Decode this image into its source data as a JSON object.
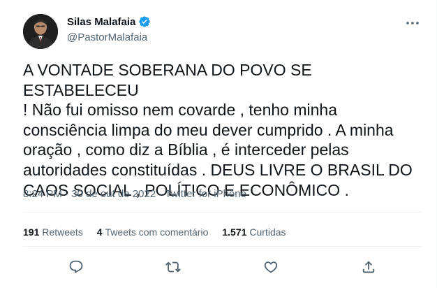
{
  "tweet": {
    "author_name": "Silas Malafaia",
    "author_handle": "@PastorMalafaia",
    "text": "A VONTADE SOBERANA DO POVO SE ESTABELECEU\n! Não fui omisso nem covarde , tenho minha\nconsciência limpa do meu dever cumprido . A minha\noração , como diz a Bíblia , é interceder pelas\nautoridades constituídas . DEUS LIVRE O BRASIL DO\nCAOS SOCIAL , POLÍTICO E ECONÔMICO .",
    "time": "8:24 PM",
    "dot": "·",
    "date": "30 de out de 2022",
    "source": "Twitter for iPhone"
  },
  "stats": {
    "retweets_count": "191",
    "retweets_label": "Retweets",
    "quotes_count": "4",
    "quotes_label": "Tweets com comentário",
    "likes_count": "1.571",
    "likes_label": "Curtidas"
  },
  "icons": {
    "verified": "verified-badge-icon",
    "more": "more-options-icon",
    "reply": "reply-icon",
    "retweet": "retweet-icon",
    "like": "like-icon",
    "share": "share-icon"
  },
  "colors": {
    "text": "#0f1419",
    "secondary": "#536471",
    "verified": "#1d9bf0",
    "divider": "#eff3f4"
  }
}
